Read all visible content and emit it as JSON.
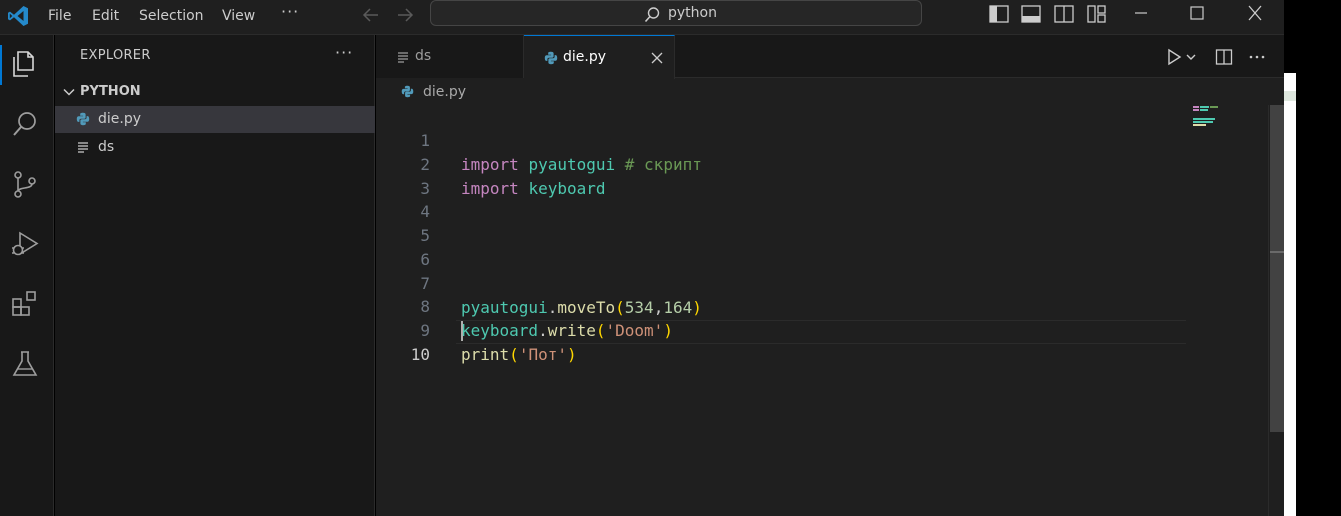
{
  "titlebar": {
    "menu": [
      "File",
      "Edit",
      "Selection",
      "View"
    ],
    "more": "···",
    "search_text": "python"
  },
  "activity_bar": {
    "items": [
      "explorer-icon",
      "search-icon",
      "source-control-icon",
      "run-debug-icon",
      "extensions-icon",
      "testing-icon"
    ],
    "active": "explorer-icon",
    "accent_color": "#0078d4"
  },
  "sidebar": {
    "title": "EXPLORER",
    "more": "···",
    "folder": "PYTHON",
    "files": [
      {
        "name": "die.py",
        "icon": "python-file-icon",
        "selected": true
      },
      {
        "name": "ds",
        "icon": "text-file-icon",
        "selected": false
      }
    ]
  },
  "editor": {
    "tabs": [
      {
        "label": "ds",
        "icon": "text-file-icon",
        "active": false
      },
      {
        "label": "die.py",
        "icon": "python-file-icon",
        "active": true
      }
    ],
    "breadcrumb": "die.py",
    "line_numbers": [
      "1",
      "2",
      "3",
      "4",
      "5",
      "6",
      "7",
      "8",
      "9",
      "10"
    ],
    "current_line": "10",
    "code": {
      "l1_kw": "import",
      "l1_mod": "pyautogui",
      "l1_comment": "# скрипт",
      "l2_kw": "import",
      "l2_mod": "keyboard",
      "l7_obj": "pyautogui",
      "l7_dot": ".",
      "l7_fn": "moveTo",
      "l7_open": "(",
      "l7_arg1": "534",
      "l7_comma": ",",
      "l7_arg2": "164",
      "l7_close": ")",
      "l8_obj": "keyboard",
      "l8_dot": ".",
      "l8_fn": "write",
      "l8_open": "(",
      "l8_str": "'Doom'",
      "l8_close": ")",
      "l9_fn": "print",
      "l9_open": "(",
      "l9_str": "'Пот'",
      "l9_close": ")"
    }
  },
  "colors": {
    "keyword": "#c586c0",
    "module": "#4ec9b0",
    "comment": "#6a9955",
    "function": "#dcdcaa",
    "number": "#b5cea8",
    "string": "#ce9178",
    "accent": "#0078d4"
  }
}
